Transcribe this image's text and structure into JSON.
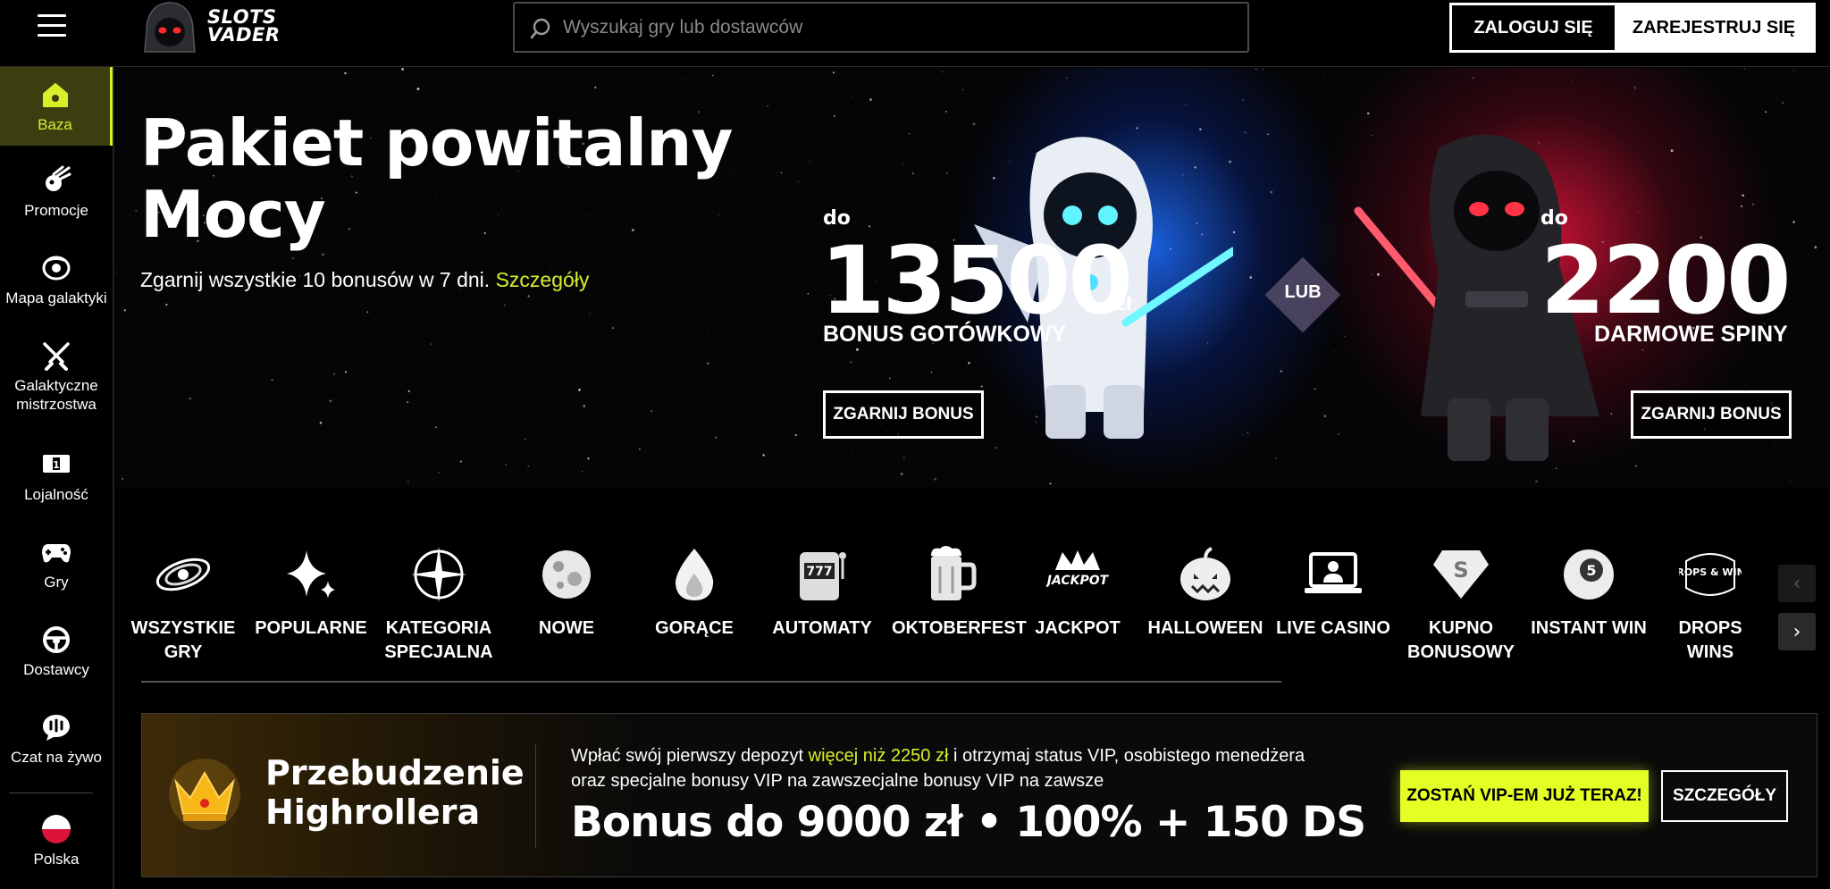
{
  "header": {
    "logo_line1": "SLOTS",
    "logo_line2": "VADER",
    "search_placeholder": "Wyszukaj gry lub dostawców",
    "login_label": "ZALOGUJ SIĘ",
    "register_label": "ZAREJESTRUJ SIĘ"
  },
  "sidebar": {
    "items": [
      {
        "label": "Baza",
        "icon": "home-icon",
        "active": true
      },
      {
        "label": "Promocje",
        "icon": "comet-icon"
      },
      {
        "label": "Mapa galaktyki",
        "icon": "galaxy-map-icon"
      },
      {
        "label": "Galaktyczne mistrzostwa",
        "icon": "crossed-sabers-icon"
      },
      {
        "label": "Lojalność",
        "icon": "loyalty-icon"
      },
      {
        "label": "Gry",
        "icon": "gamepad-icon"
      },
      {
        "label": "Dostawcy",
        "icon": "steering-wheel-icon"
      },
      {
        "label": "Czat na żywo",
        "icon": "chat-icon"
      },
      {
        "label": "Polska",
        "icon": "poland-flag-icon"
      }
    ]
  },
  "hero": {
    "title_line1": "Pakiet powitalny",
    "title_line2": "Mocy",
    "subtitle": "Zgarnij wszystkie 10 bonusów w 7 dni.",
    "details_link": "Szczegóły",
    "offer_left": {
      "prefix": "do",
      "amount": "13500",
      "currency": "zł",
      "label": "BONUS GOTÓWKOWY",
      "button": "ZGARNIJ BONUS"
    },
    "separator": "LUB",
    "offer_right": {
      "prefix": "do",
      "amount": "2200",
      "label": "DARMOWE SPINY",
      "button": "ZGARNIJ BONUS"
    }
  },
  "categories": {
    "items": [
      {
        "label": "WSZYSTKIE GRY",
        "icon": "galaxy-icon"
      },
      {
        "label": "POPULARNE",
        "icon": "sparkle-icon"
      },
      {
        "label": "KATEGORIA SPECJALNA",
        "icon": "compass-star-icon"
      },
      {
        "label": "NOWE",
        "icon": "planet-icon"
      },
      {
        "label": "GORĄCE",
        "icon": "flame-icon"
      },
      {
        "label": "AUTOMATY",
        "icon": "slot-machine-icon"
      },
      {
        "label": "OKTOBERFEST",
        "icon": "beer-mug-icon"
      },
      {
        "label": "JACKPOT",
        "icon": "jackpot-crown-icon",
        "icon_text": "JACKPOT"
      },
      {
        "label": "HALLOWEEN",
        "icon": "pumpkin-icon"
      },
      {
        "label": "LIVE CASINO",
        "icon": "live-dealer-laptop-icon"
      },
      {
        "label": "KUPNO BONUSOWY",
        "icon": "diamond-s-icon",
        "icon_text": "S"
      },
      {
        "label": "INSTANT WIN",
        "icon": "billiard-ball-icon",
        "icon_text": "5"
      },
      {
        "label": "DROPS WINS",
        "icon": "drops-wins-icon",
        "icon_text": "DROPS & WINS"
      }
    ],
    "prev_arrow": "‹",
    "next_arrow": "›"
  },
  "promo": {
    "title_line1": "Przebudzenie",
    "title_line2": "Highrollera",
    "desc_pre": "Wpłać swój pierwszy depozyt",
    "desc_highlight": "więcej niż 2250 zł",
    "desc_post": "i otrzymaj status VIP, osobistego menedżera oraz specjalne bonusy VIP na zawszecjalne bonusy VIP na zawsze",
    "headline": "Bonus do 9000 zł • 100% + 150 DS",
    "vip_button": "ZOSTAŃ VIP-EM JUŻ TERAZ!",
    "details_button": "SZCZEGÓŁY"
  },
  "colors": {
    "accent": "#d8ef2a",
    "vip_button": "#e4ff24",
    "background": "#000000"
  }
}
